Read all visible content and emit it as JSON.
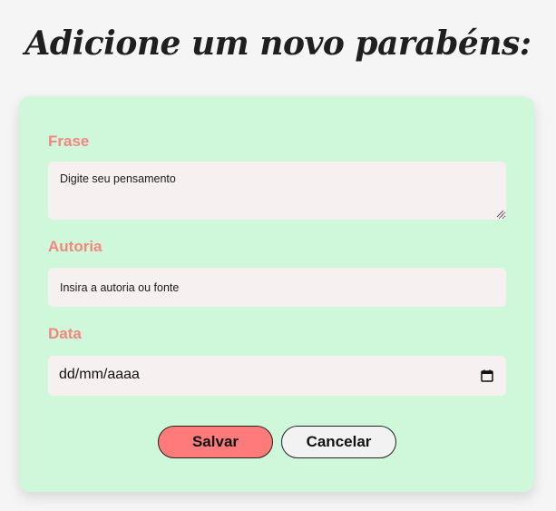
{
  "header": {
    "title": "Adicione um novo parabéns:"
  },
  "form": {
    "frase": {
      "label": "Frase",
      "placeholder": "Digite seu pensamento"
    },
    "autoria": {
      "label": "Autoria",
      "placeholder": "Insira a autoria ou fonte"
    },
    "data": {
      "label": "Data",
      "placeholder": "dd/mm/aaaa",
      "icon": "calendar-icon"
    }
  },
  "actions": {
    "save_label": "Salvar",
    "cancel_label": "Cancelar"
  },
  "colors": {
    "background": "#f5f5f5",
    "card": "#cff8da",
    "label": "#f48580",
    "input_bg": "#f7f0f0",
    "save_button": "#ff7b7b",
    "cancel_button": "#f2f2f2"
  }
}
